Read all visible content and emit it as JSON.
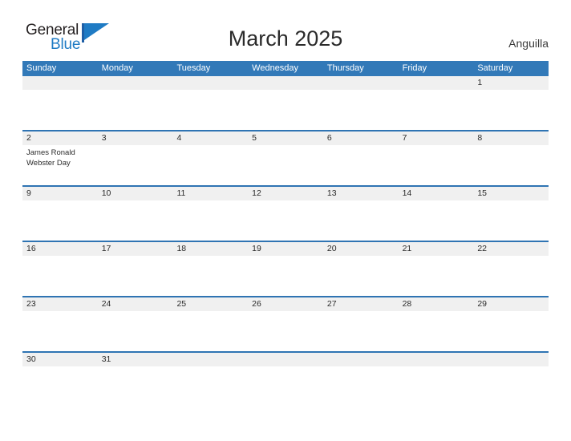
{
  "brand": {
    "name_part1": "General",
    "name_part2": "Blue",
    "color_dark": "#231f20",
    "color_blue": "#1f7bc4"
  },
  "header": {
    "title": "March 2025",
    "location": "Anguilla"
  },
  "theme": {
    "header_blue": "#3279b8",
    "row_divider_blue": "#2f74b3",
    "band_gray": "#f0f0f0",
    "text_dark": "#2b2b2b"
  },
  "calendar": {
    "weekday_headers": [
      "Sunday",
      "Monday",
      "Tuesday",
      "Wednesday",
      "Thursday",
      "Friday",
      "Saturday"
    ],
    "weeks": [
      {
        "days": [
          {
            "num": "",
            "events": []
          },
          {
            "num": "",
            "events": []
          },
          {
            "num": "",
            "events": []
          },
          {
            "num": "",
            "events": []
          },
          {
            "num": "",
            "events": []
          },
          {
            "num": "",
            "events": []
          },
          {
            "num": "1",
            "events": []
          }
        ]
      },
      {
        "days": [
          {
            "num": "2",
            "events": [
              "James Ronald Webster Day"
            ]
          },
          {
            "num": "3",
            "events": []
          },
          {
            "num": "4",
            "events": []
          },
          {
            "num": "5",
            "events": []
          },
          {
            "num": "6",
            "events": []
          },
          {
            "num": "7",
            "events": []
          },
          {
            "num": "8",
            "events": []
          }
        ]
      },
      {
        "days": [
          {
            "num": "9",
            "events": []
          },
          {
            "num": "10",
            "events": []
          },
          {
            "num": "11",
            "events": []
          },
          {
            "num": "12",
            "events": []
          },
          {
            "num": "13",
            "events": []
          },
          {
            "num": "14",
            "events": []
          },
          {
            "num": "15",
            "events": []
          }
        ]
      },
      {
        "days": [
          {
            "num": "16",
            "events": []
          },
          {
            "num": "17",
            "events": []
          },
          {
            "num": "18",
            "events": []
          },
          {
            "num": "19",
            "events": []
          },
          {
            "num": "20",
            "events": []
          },
          {
            "num": "21",
            "events": []
          },
          {
            "num": "22",
            "events": []
          }
        ]
      },
      {
        "days": [
          {
            "num": "23",
            "events": []
          },
          {
            "num": "24",
            "events": []
          },
          {
            "num": "25",
            "events": []
          },
          {
            "num": "26",
            "events": []
          },
          {
            "num": "27",
            "events": []
          },
          {
            "num": "28",
            "events": []
          },
          {
            "num": "29",
            "events": []
          }
        ]
      },
      {
        "days": [
          {
            "num": "30",
            "events": []
          },
          {
            "num": "31",
            "events": []
          },
          {
            "num": "",
            "events": []
          },
          {
            "num": "",
            "events": []
          },
          {
            "num": "",
            "events": []
          },
          {
            "num": "",
            "events": []
          },
          {
            "num": "",
            "events": []
          }
        ]
      }
    ]
  }
}
